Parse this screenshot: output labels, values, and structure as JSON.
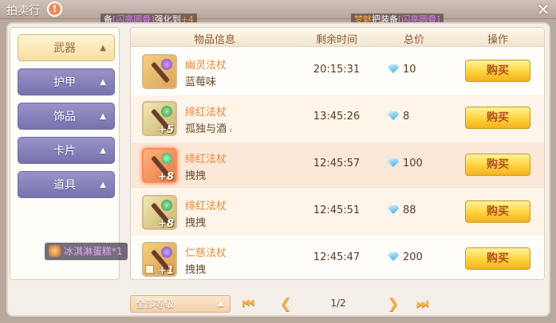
{
  "window": {
    "title": "拍卖行",
    "help_glyph": "!",
    "close_glyph": "✕"
  },
  "ticker": {
    "left": {
      "prefix": "备",
      "item": "[闪亮圆骨]",
      "action": "强化到",
      "level": "+4"
    },
    "right": {
      "player": "梦魅",
      "action": "把装备",
      "item": "[闪亮圆骨]"
    }
  },
  "categories": [
    {
      "label": "武器",
      "active": true
    },
    {
      "label": "护甲",
      "active": false
    },
    {
      "label": "饰品",
      "active": false
    },
    {
      "label": "卡片",
      "active": false
    },
    {
      "label": "道具",
      "active": false
    }
  ],
  "category_arrow": "▲",
  "ice_badge": "冰淇淋蛋糕*1",
  "table": {
    "headers": {
      "item_info": "物品信息",
      "time_left": "剩余时间",
      "total_price": "总价",
      "action": "操作"
    },
    "rows": [
      {
        "name": "幽灵法杖",
        "seller": "蓝莓味",
        "refine": "",
        "time": "20:15:31",
        "price": "10",
        "buy": "购买",
        "icon": "ghost-staff-icon"
      },
      {
        "name": "绯红法杖",
        "seller": "孤独与酒",
        "seller_mark": "ı",
        "refine": "+5",
        "time": "13:45:26",
        "price": "8",
        "buy": "购买",
        "icon": "crimson-staff-icon"
      },
      {
        "name": "绯红法杖",
        "seller": "拽拽",
        "refine": "+8",
        "time": "12:45:57",
        "price": "100",
        "buy": "购买",
        "icon": "crimson-staff-icon"
      },
      {
        "name": "绯红法杖",
        "seller": "拽拽",
        "refine": "+8",
        "time": "12:45:51",
        "price": "88",
        "buy": "购买",
        "icon": "crimson-staff-icon"
      },
      {
        "name": "仁慈法杖",
        "seller": "拽拽",
        "refine": "+1",
        "time": "12:45:47",
        "price": "200",
        "buy": "购买",
        "icon": "mercy-staff-icon"
      }
    ]
  },
  "footer": {
    "level_filter": "全部等级",
    "level_caret": "▲",
    "first_glyph": "⏮",
    "prev_glyph": "❮",
    "next_glyph": "❯",
    "last_glyph": "⏭",
    "page": "1/2"
  }
}
